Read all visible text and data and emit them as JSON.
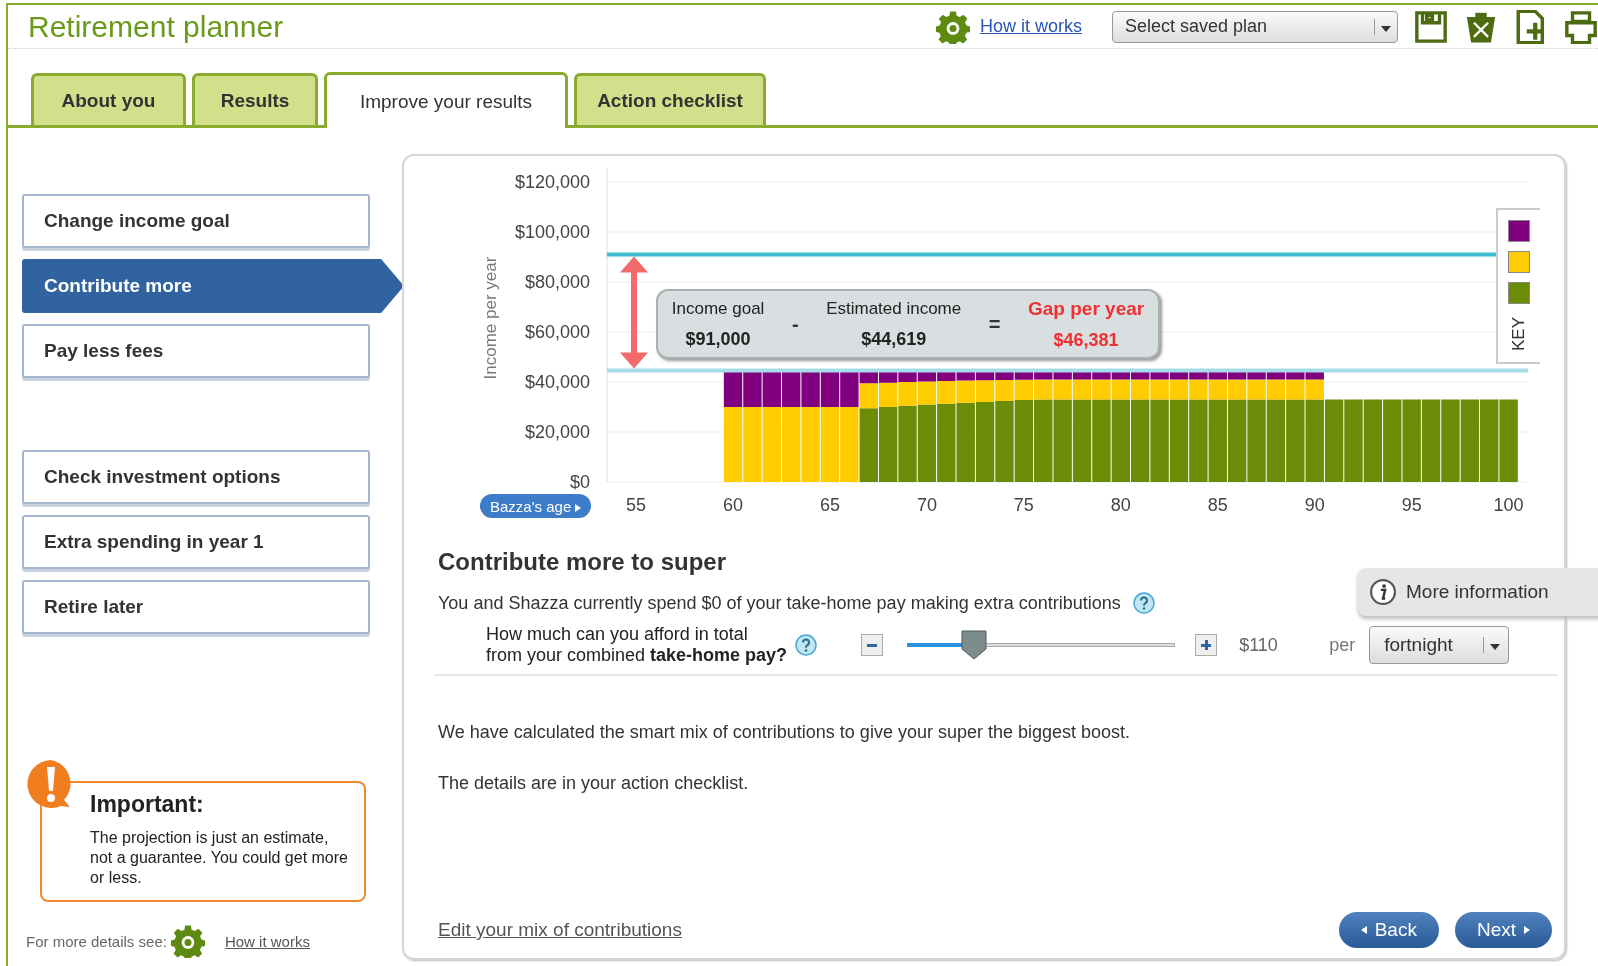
{
  "header": {
    "title": "Retirement planner",
    "help_link": "How it works",
    "saved_plan_select": {
      "value": "Select saved plan"
    }
  },
  "tabs": [
    {
      "label": "About you",
      "selected": false
    },
    {
      "label": "Results",
      "selected": false
    },
    {
      "label": "Improve your results",
      "selected": true
    },
    {
      "label": "Action checklist",
      "selected": false
    }
  ],
  "sidebar": {
    "groups": [
      {
        "items": [
          {
            "label": "Change income goal",
            "selected": false
          },
          {
            "label": "Contribute more",
            "selected": true
          },
          {
            "label": "Pay less fees",
            "selected": false
          }
        ]
      },
      {
        "items": [
          {
            "label": "Check investment options",
            "selected": false
          },
          {
            "label": "Extra spending in year 1",
            "selected": false
          },
          {
            "label": "Retire later",
            "selected": false
          }
        ]
      }
    ],
    "notice": {
      "title": "Important:",
      "text": "The projection is just an estimate, not a guarantee. You could get more or less."
    },
    "footer": {
      "text": "For more details see:",
      "link": "How it works"
    }
  },
  "chart": {
    "age_button": "Bazza's age",
    "key_label": "KEY",
    "callout": [
      {
        "kind": "term",
        "label": "Income goal",
        "value": "$91,000"
      },
      {
        "kind": "operator",
        "symbol": "-"
      },
      {
        "kind": "term",
        "label": "Estimated income",
        "value": "$44,619"
      },
      {
        "kind": "operator",
        "symbol": "="
      },
      {
        "kind": "gap",
        "label": "Gap per year",
        "value": "$46,381"
      }
    ],
    "chart_data": {
      "type": "bar",
      "stacked": true,
      "ylabel": "Income per year",
      "x": [
        60,
        61,
        62,
        63,
        64,
        65,
        66,
        67,
        68,
        69,
        70,
        71,
        72,
        73,
        74,
        75,
        76,
        77,
        78,
        79,
        80,
        81,
        82,
        83,
        84,
        85,
        86,
        87,
        88,
        89,
        90,
        91,
        92,
        93,
        94,
        95,
        96,
        97,
        98,
        99,
        100
      ],
      "xlim": [
        53.5,
        101
      ],
      "ylim": [
        0,
        120000
      ],
      "xticks": [
        55,
        60,
        65,
        70,
        75,
        80,
        85,
        90,
        95,
        100
      ],
      "yticks": [
        {
          "value": 0,
          "label": "$0"
        },
        {
          "value": 20000,
          "label": "$20,000"
        },
        {
          "value": 40000,
          "label": "$40,000"
        },
        {
          "value": 60000,
          "label": "$60,000"
        },
        {
          "value": 80000,
          "label": "$80,000"
        },
        {
          "value": 100000,
          "label": "$100,000"
        },
        {
          "value": 120000,
          "label": "$120,000"
        }
      ],
      "series": [
        {
          "color": "#6b8c06",
          "values": [
            0,
            0,
            0,
            0,
            0,
            0,
            0,
            29500,
            30000,
            30500,
            31000,
            31300,
            31700,
            32000,
            32400,
            32800,
            33000,
            33000,
            33000,
            33000,
            33000,
            33000,
            33000,
            33000,
            33000,
            33000,
            33000,
            33000,
            33000,
            33000,
            33000,
            33000,
            33000,
            33000,
            33000,
            33000,
            33000,
            33000,
            33000,
            33000,
            33000
          ]
        },
        {
          "color": "#ffcc00",
          "values": [
            30000,
            30000,
            30000,
            30000,
            30000,
            30000,
            30000,
            10000,
            9700,
            9500,
            9200,
            9100,
            8900,
            8700,
            8400,
            8100,
            8000,
            8000,
            8000,
            8000,
            8000,
            8000,
            8000,
            8000,
            8000,
            8000,
            8000,
            8000,
            8000,
            8000,
            8000,
            0,
            0,
            0,
            0,
            0,
            0,
            0,
            0,
            0,
            0
          ]
        },
        {
          "color": "#800080",
          "values": [
            14600,
            14600,
            14600,
            14600,
            14600,
            14600,
            14600,
            5100,
            4900,
            4600,
            4400,
            4200,
            4000,
            3900,
            3800,
            3700,
            3600,
            3600,
            3600,
            3600,
            3600,
            3600,
            3600,
            3600,
            3600,
            3600,
            3600,
            3600,
            3600,
            3600,
            3600,
            0,
            0,
            0,
            0,
            0,
            0,
            0,
            0,
            0,
            0
          ]
        }
      ],
      "grid": true,
      "ref_lines": [
        {
          "axis": "y",
          "value": 91000,
          "color": "#3bbcd0"
        },
        {
          "axis": "y",
          "value": 44619,
          "color": "#a6dbe8"
        }
      ]
    }
  },
  "section": {
    "title": "Contribute more to super",
    "more_info": "More information",
    "intro": "You and Shazza currently spend $0 of your take-home pay making extra contributions",
    "question": "How much can you afford in total\nfrom your combined **take-home pay?**",
    "slider": {
      "level": 0.25
    },
    "amount": "$110",
    "per_label": "per",
    "period_select": {
      "value": "fortnight"
    },
    "paragraphs": [
      "We have calculated the smart mix of contributions to give your super the biggest boost.",
      "The details are in your action checklist."
    ],
    "edit_link": "Edit your mix of contributions",
    "buttons": [
      {
        "kind": "back",
        "label": "Back"
      },
      {
        "kind": "next",
        "label": "Next"
      }
    ]
  }
}
